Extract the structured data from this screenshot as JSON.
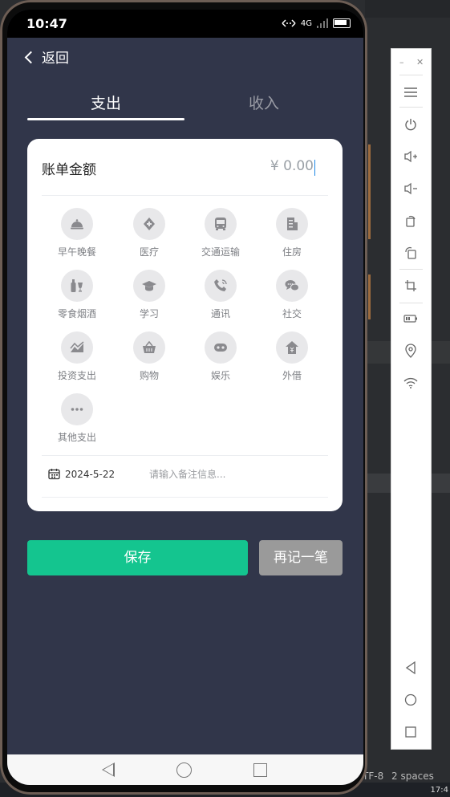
{
  "phone": {
    "status_time": "10:47",
    "network": "4G",
    "back_label": "返回",
    "tabs": [
      {
        "label": "支出",
        "active": true
      },
      {
        "label": "收入",
        "active": false
      }
    ],
    "amount": {
      "label": "账单金额",
      "value": "¥ 0.00"
    },
    "categories": [
      {
        "label": "早午晚餐",
        "icon": "food-cloche-icon"
      },
      {
        "label": "医疗",
        "icon": "medical-icon"
      },
      {
        "label": "交通运输",
        "icon": "bus-icon"
      },
      {
        "label": "住房",
        "icon": "building-icon"
      },
      {
        "label": "零食烟酒",
        "icon": "wine-icon"
      },
      {
        "label": "学习",
        "icon": "graduation-cap-icon"
      },
      {
        "label": "通讯",
        "icon": "phone-icon"
      },
      {
        "label": "社交",
        "icon": "chat-bubbles-icon"
      },
      {
        "label": "投资支出",
        "icon": "trend-chart-icon"
      },
      {
        "label": "购物",
        "icon": "basket-icon"
      },
      {
        "label": "娱乐",
        "icon": "gamepad-icon"
      },
      {
        "label": "外借",
        "icon": "lend-house-icon"
      },
      {
        "label": "其他支出",
        "icon": "more-dots-icon"
      }
    ],
    "date": "2024-5-22",
    "note_placeholder": "请输入备注信息...",
    "save_label": "保存",
    "again_label": "再记一笔"
  },
  "ide_status": {
    "encoding": "TF-8",
    "indent": "2 spaces"
  },
  "taskbar_time": "17:4",
  "colors": {
    "screen_bg": "#31364a",
    "save_green": "#14c58f",
    "again_gray": "#9a9a9a",
    "icon_bg": "#e8e8ea",
    "icon_fg": "#8a8a8e"
  }
}
